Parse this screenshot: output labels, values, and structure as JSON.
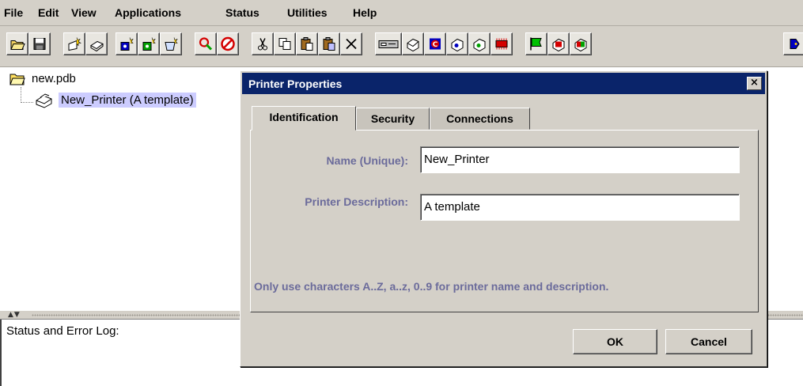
{
  "menu": [
    "File",
    "Edit",
    "View",
    "Applications",
    "Status",
    "Utilities",
    "Help"
  ],
  "toolbar": {
    "buttons": [
      {
        "icon": "open-folder-icon"
      },
      {
        "icon": "save-icon"
      },
      {
        "icon": "new-item-icon"
      },
      {
        "icon": "new-printer-icon"
      },
      {
        "icon": "new-blue-object-icon"
      },
      {
        "icon": "new-green-object-icon"
      },
      {
        "icon": "new-queue-icon"
      },
      {
        "icon": "find-icon"
      },
      {
        "icon": "stop-icon"
      },
      {
        "icon": "cut-icon"
      },
      {
        "icon": "copy-icon"
      },
      {
        "icon": "paste-icon"
      },
      {
        "icon": "paste-special-icon"
      },
      {
        "icon": "delete-icon"
      },
      {
        "icon": "device-icon"
      },
      {
        "icon": "printer-icon"
      },
      {
        "icon": "red-printer-icon"
      },
      {
        "icon": "printer-config-icon"
      },
      {
        "icon": "printer-status-icon"
      },
      {
        "icon": "network-card-icon"
      },
      {
        "icon": "green-flag-icon"
      },
      {
        "icon": "printer-alert-icon"
      },
      {
        "icon": "printer-warning-icon"
      },
      {
        "icon": "blue-tag-icon"
      }
    ],
    "colors": {
      "face": "#d4d0c8",
      "accent_red": "#d40000",
      "accent_green": "#00a000",
      "accent_blue": "#0000c0"
    }
  },
  "tree": {
    "root_label": "new.pdb",
    "child_label": "New_Printer (A template)",
    "selection_color": "#ccccff"
  },
  "log": {
    "label": "Status and Error Log:"
  },
  "dialog": {
    "title": "Printer Properties",
    "close_glyph": "×",
    "title_color": "#0a246a",
    "tabs": [
      "Identification",
      "Security",
      "Connections"
    ],
    "active_tab": "Identification",
    "fields": {
      "name_label": "Name (Unique):",
      "name_value": "New_Printer",
      "description_label": "Printer Description:",
      "description_value": "A template"
    },
    "hint": "Only use characters A..Z, a..z, 0..9 for printer name and description.",
    "label_color": "#6b6b9b",
    "ok_label": "OK",
    "cancel_label": "Cancel"
  }
}
